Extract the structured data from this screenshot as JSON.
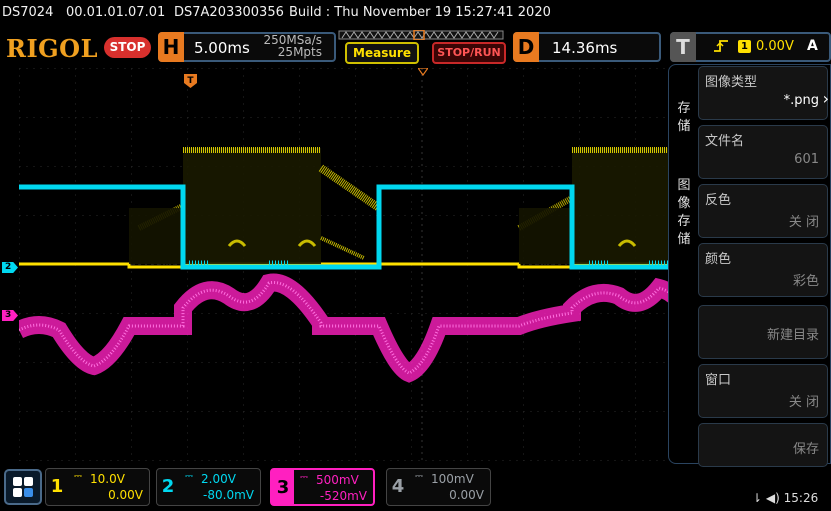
{
  "info_bar": {
    "model": "DS7024",
    "firmware": "00.01.01.07.01",
    "serial": "DS7A203300356",
    "build": "Build : Thu November 19 15:27:41 2020"
  },
  "header": {
    "brand": "RIGOL",
    "run_state": "STOP",
    "horizontal": {
      "letter": "H",
      "scale": "5.00ms",
      "sample_rate": "250MSa/s",
      "memory_depth": "25Mpts"
    },
    "measure_label": "Measure",
    "stoprun_label": "STOP/RUN",
    "delay": {
      "letter": "D",
      "value": "14.36ms"
    },
    "trigger": {
      "letter": "T",
      "slope_icon": "rising-edge-icon",
      "source": "1",
      "level": "0.00V",
      "mode": "A"
    }
  },
  "waveform_markers": {
    "trigger_marker": "T",
    "ch2_marker": "2",
    "ch3_marker": "3"
  },
  "menu": {
    "cat_storage": "存储",
    "cat_image_storage": "图像存储",
    "items": [
      {
        "label": "图像类型",
        "value": "*.png"
      },
      {
        "label": "文件名",
        "value": "601"
      },
      {
        "label": "反色",
        "value": "关 闭"
      },
      {
        "label": "颜色",
        "value": "彩色"
      },
      {
        "label": "新建目录"
      },
      {
        "label": "窗口",
        "value": "关 闭"
      },
      {
        "label": "保存"
      }
    ]
  },
  "channels": [
    {
      "num": "1",
      "scale": "10.0V",
      "offset": "0.00V",
      "color": "#ffe000"
    },
    {
      "num": "2",
      "scale": "2.00V",
      "offset": "-80.0mV",
      "color": "#00d8f0"
    },
    {
      "num": "3",
      "scale": "500mV",
      "offset": "-520mV",
      "color": "#ff20c0"
    },
    {
      "num": "4",
      "scale": "100mV",
      "offset": "0.00V",
      "color": "#9aa0a6"
    }
  ],
  "status": {
    "usb_icon": "usb-icon",
    "speaker_icon": "speaker-icon",
    "time": "15:26"
  }
}
